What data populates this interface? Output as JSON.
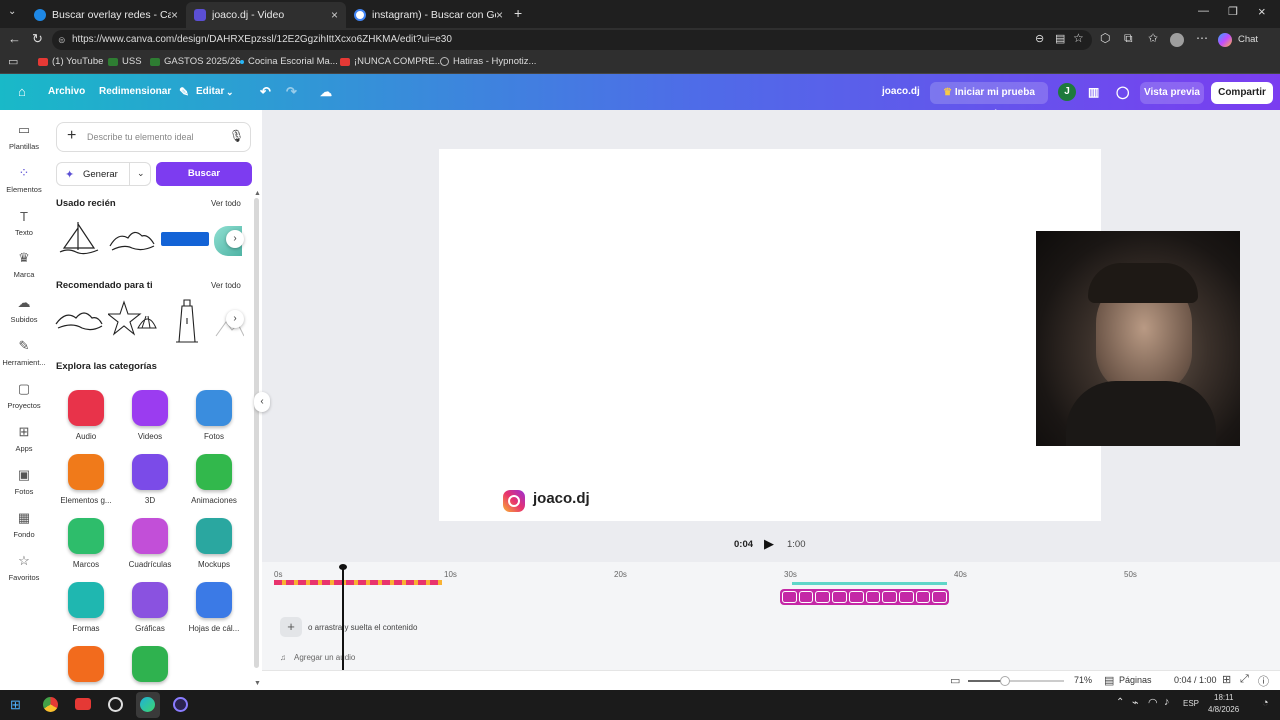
{
  "browser": {
    "tabs": [
      {
        "title": "Buscar overlay redes - Canva",
        "color": "#1e88e5"
      },
      {
        "title": "joaco.dj - Video",
        "color": "#5b4fd4"
      },
      {
        "title": "instagram) - Buscar con Google",
        "color": "#ffffff"
      }
    ],
    "url": "https://www.canva.com/design/DAHRXEpzssl/12E2GgzihIttXcxo6ZHKMA/edit?ui=e30",
    "copilot_label": "Chat",
    "bookmarks": [
      {
        "label": "(1) YouTube",
        "color": "#e53935"
      },
      {
        "label": "USS",
        "color": "#2e7d32"
      },
      {
        "label": "GASTOS 2025/26",
        "color": "#2e7d32"
      },
      {
        "label": "Cocina Escorial Ma...",
        "color": "#29b6f6"
      },
      {
        "label": "¡NUNCA COMPRE...",
        "color": "#e53935"
      },
      {
        "label": "Hatiras - Hypnotiz...",
        "color": "#bbbbbb"
      }
    ]
  },
  "canva_header": {
    "file": "Archivo",
    "resize": "Redimensionar",
    "edit": "Editar",
    "design_name": "joaco.dj",
    "trial": "Iniciar mi prueba gratis",
    "avatar_letter": "J",
    "preview": "Vista previa",
    "share": "Compartir"
  },
  "rail": [
    {
      "label": "Plantillas",
      "icon": "templates-icon",
      "glyph": "▭"
    },
    {
      "label": "Elementos",
      "icon": "elements-icon",
      "glyph": "⁘"
    },
    {
      "label": "Texto",
      "icon": "text-icon",
      "glyph": "T"
    },
    {
      "label": "Marca",
      "icon": "brand-icon",
      "glyph": "♛"
    },
    {
      "label": "Subidos",
      "icon": "uploads-icon",
      "glyph": "☁"
    },
    {
      "label": "Herramient...",
      "icon": "tools-icon",
      "glyph": "✎"
    },
    {
      "label": "Proyectos",
      "icon": "projects-icon",
      "glyph": "▢"
    },
    {
      "label": "Apps",
      "icon": "apps-icon",
      "glyph": "⊞"
    },
    {
      "label": "Fotos",
      "icon": "photos-icon",
      "glyph": "▣"
    },
    {
      "label": "Fondo",
      "icon": "background-icon",
      "glyph": "▦"
    },
    {
      "label": "Favoritos",
      "icon": "favorites-icon",
      "glyph": "☆"
    }
  ],
  "panel": {
    "search_placeholder": "Describe tu elemento ideal",
    "generate": "Generar",
    "search_button": "Buscar",
    "recent_title": "Usado recién",
    "see_all": "Ver todo",
    "recommended_title": "Recomendado para ti",
    "categories_title": "Explora las categorías",
    "categories": [
      {
        "label": "Audio",
        "color": "#e8334a"
      },
      {
        "label": "Videos",
        "color": "#9b3cf0"
      },
      {
        "label": "Fotos",
        "color": "#3a8dde"
      },
      {
        "label": "Elementos g...",
        "color": "#f07a1a"
      },
      {
        "label": "3D",
        "color": "#7b4be8"
      },
      {
        "label": "Animaciones",
        "color": "#32b84c"
      },
      {
        "label": "Marcos",
        "color": "#2ebd6b"
      },
      {
        "label": "Cuadrículas",
        "color": "#c24fd8"
      },
      {
        "label": "Mockups",
        "color": "#2aa7a0"
      },
      {
        "label": "Formas",
        "color": "#1fb7b0"
      },
      {
        "label": "Gráficas",
        "color": "#8a52e0"
      },
      {
        "label": "Hojas de cál...",
        "color": "#3b7ae6"
      },
      {
        "label": "",
        "color": "#f26b1d"
      },
      {
        "label": "",
        "color": "#2fb24f"
      }
    ]
  },
  "canvas": {
    "handle": "joaco.dj"
  },
  "playback": {
    "current": "0:04",
    "total": "1:00"
  },
  "timeline": {
    "ticks": [
      "0s",
      "10s",
      "20s",
      "30s",
      "40s",
      "50s"
    ],
    "drop_text": "o arrastra y suelta el contenido",
    "add_audio": "Agregar un audio"
  },
  "status_bar": {
    "zoom": "71%",
    "zoom_level": 0.71,
    "pages": "Páginas",
    "time": "0:04 / 1:00"
  },
  "taskbar": {
    "lang": "ESP",
    "clock": "18:11",
    "date": "4/8/2026"
  }
}
